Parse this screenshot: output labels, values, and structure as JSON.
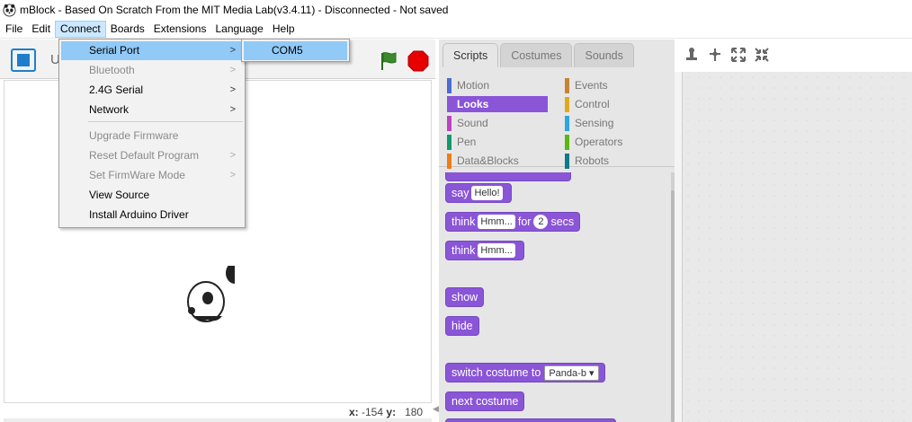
{
  "window": {
    "title": "mBlock - Based On Scratch From the MIT Media Lab(v3.4.11) - Disconnected - Not saved",
    "icon": "panda-app-icon"
  },
  "menubar": {
    "items": [
      "File",
      "Edit",
      "Connect",
      "Boards",
      "Extensions",
      "Language",
      "Help"
    ],
    "active": "Connect"
  },
  "connect_menu": {
    "items": [
      {
        "label": "Serial Port",
        "enabled": true,
        "submenu": true,
        "highlighted": true
      },
      {
        "label": "Bluetooth",
        "enabled": false,
        "submenu": true
      },
      {
        "label": "2.4G Serial",
        "enabled": true,
        "submenu": true
      },
      {
        "label": "Network",
        "enabled": true,
        "submenu": true
      },
      {
        "label": "Upgrade Firmware",
        "enabled": false,
        "submenu": false
      },
      {
        "label": "Reset Default Program",
        "enabled": false,
        "submenu": true
      },
      {
        "label": "Set FirmWare Mode",
        "enabled": false,
        "submenu": true
      },
      {
        "label": "View Source",
        "enabled": true,
        "submenu": false
      },
      {
        "label": "Install Arduino Driver",
        "enabled": true,
        "submenu": false
      }
    ],
    "arrow_glyph": ">"
  },
  "serial_port_submenu": {
    "items": [
      "COM5"
    ]
  },
  "stage": {
    "project_name_prefix": "U",
    "coords": {
      "x_label": "x:",
      "x_value": "-154",
      "y_label": "y:",
      "y_value": "180"
    }
  },
  "palette": {
    "tabs": [
      "Scripts",
      "Costumes",
      "Sounds"
    ],
    "active_tab": "Scripts",
    "categories": [
      {
        "label": "Motion",
        "color": "#4a6cd4"
      },
      {
        "label": "Events",
        "color": "#c88330"
      },
      {
        "label": "Looks",
        "color": "#8a55d7"
      },
      {
        "label": "Control",
        "color": "#e1a91a"
      },
      {
        "label": "Sound",
        "color": "#bb42c3"
      },
      {
        "label": "Sensing",
        "color": "#2ca5e2"
      },
      {
        "label": "Pen",
        "color": "#0e9a6c"
      },
      {
        "label": "Operators",
        "color": "#5cb712"
      },
      {
        "label": "Data&Blocks",
        "color": "#ee7d16"
      },
      {
        "label": "Robots",
        "color": "#0f7a8a"
      }
    ],
    "selected_category": "Looks",
    "blocks": {
      "say": {
        "word": "say",
        "arg": "Hello!"
      },
      "think_for": {
        "word": "think",
        "arg": "Hmm...",
        "for": "for",
        "secs_value": "2",
        "secs": "secs"
      },
      "think": {
        "word": "think",
        "arg": "Hmm..."
      },
      "show": "show",
      "hide": "hide",
      "switch_costume": {
        "label": "switch costume to",
        "arg": "Panda-b"
      },
      "next_costume": "next costume"
    }
  },
  "script_tools": [
    "stamp-icon",
    "cut-icon",
    "grow-icon",
    "shrink-icon"
  ]
}
